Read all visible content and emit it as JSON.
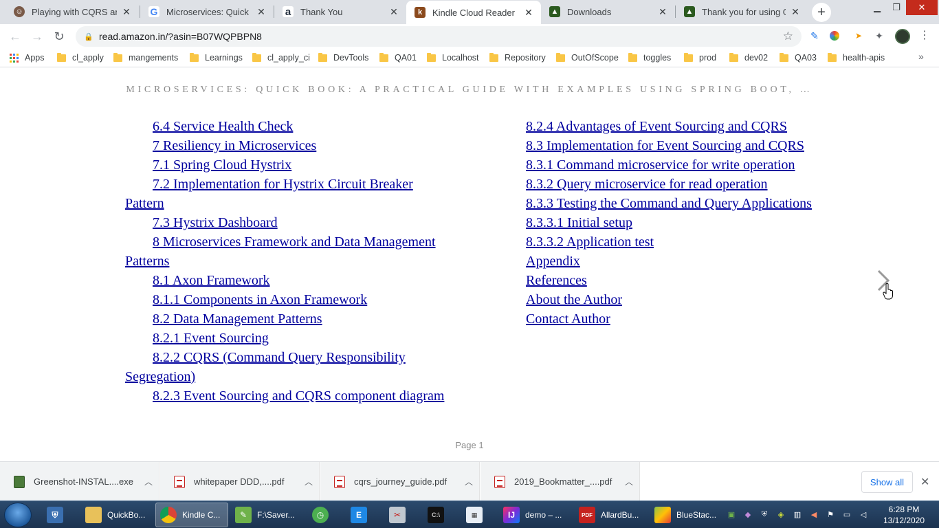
{
  "browser": {
    "tabs": [
      {
        "title": "Playing with CQRS and E",
        "icon": "avatar-favicon-icon",
        "color": "#7a5a48"
      },
      {
        "title": "Microservices: Quick Boo",
        "icon": "google-favicon-icon",
        "color": "#4285f4"
      },
      {
        "title": "Thank You",
        "icon": "amazon-favicon-icon",
        "color": "#232f3e"
      },
      {
        "title": "Kindle Cloud Reader",
        "icon": "kindle-favicon-icon",
        "color": "#8b4a1d"
      },
      {
        "title": "Downloads",
        "icon": "greenshot-favicon-icon",
        "color": "#2b5a1f"
      },
      {
        "title": "Thank you for using Gree",
        "icon": "greenshot-favicon-icon",
        "color": "#2b5a1f"
      }
    ],
    "active_tab": 3,
    "new_tab_symbol": "+",
    "address": "read.amazon.in/?asin=B07WQPBPN8",
    "bookmarks": [
      {
        "label": "Apps",
        "type": "apps"
      },
      {
        "label": "cl_apply",
        "type": "folder"
      },
      {
        "label": "mangements",
        "type": "folder"
      },
      {
        "label": "Learnings",
        "type": "folder"
      },
      {
        "label": "cl_apply_ci",
        "type": "folder"
      },
      {
        "label": "DevTools",
        "type": "folder"
      },
      {
        "label": "QA01",
        "type": "folder"
      },
      {
        "label": "Localhost",
        "type": "folder"
      },
      {
        "label": "Repository",
        "type": "folder"
      },
      {
        "label": "OutOfScope",
        "type": "folder"
      },
      {
        "label": "toggles",
        "type": "folder"
      },
      {
        "label": "prod",
        "type": "folder"
      },
      {
        "label": "dev02",
        "type": "folder"
      },
      {
        "label": "QA03",
        "type": "folder"
      },
      {
        "label": "health-apis",
        "type": "folder"
      }
    ],
    "bookmarks_more": "»"
  },
  "reader": {
    "book_title": "MICROSERVICES: QUICK BOOK: A PRACTICAL GUIDE WITH EXAMPLES USING SPRING BOOT, …",
    "toc_left": [
      "6.4 Service Health Check",
      "7 Resiliency in Microservices",
      "7.1 Spring Cloud Hystrix",
      "7.2 Implementation for Hystrix Circuit Breaker Pattern",
      "7.3 Hystrix Dashboard",
      "8 Microservices Framework and Data Management Patterns",
      "8.1 Axon Framework",
      "8.1.1 Components in Axon Framework",
      "8.2 Data Management Patterns",
      "8.2.1 Event Sourcing",
      "8.2.2 CQRS (Command Query Responsibility Segregation)",
      "8.2.3 Event Sourcing and CQRS component diagram"
    ],
    "toc_right": [
      "8.2.4 Advantages of Event Sourcing and CQRS",
      "8.3 Implementation for Event Sourcing and CQRS",
      "8.3.1 Command microservice for write operation",
      "8.3.2 Query microservice for read operation",
      "8.3.3 Testing the Command and Query Applications",
      "8.3.3.1 Initial setup",
      "8.3.3.2 Application test",
      "Appendix",
      "References",
      "About the Author",
      "Contact Author"
    ],
    "page_label": "Page 1",
    "link_color": "#00009e"
  },
  "downloads": {
    "items": [
      {
        "name": "Greenshot-INSTAL....exe",
        "icon": "exe-file-icon"
      },
      {
        "name": "whitepaper DDD,....pdf",
        "icon": "pdf-file-icon"
      },
      {
        "name": "cqrs_journey_guide.pdf",
        "icon": "pdf-file-icon"
      },
      {
        "name": "2019_Bookmatter_....pdf",
        "icon": "pdf-file-icon"
      }
    ],
    "show_all": "Show all"
  },
  "taskbar": {
    "items": [
      {
        "label": "",
        "icon": "windows-security-icon",
        "color": "#3a6fb0"
      },
      {
        "label": "QuickBo...",
        "icon": "folder-icon",
        "color": "#e8c15a"
      },
      {
        "label": "Kindle C...",
        "icon": "chrome-icon",
        "color": "#db4437"
      },
      {
        "label": "F:\\Saver...",
        "icon": "notepad-plus-icon",
        "color": "#6fb24a"
      },
      {
        "label": "",
        "icon": "clock-app-icon",
        "color": "#4caf50"
      },
      {
        "label": "",
        "icon": "editor-app-icon",
        "color": "#1e88e5"
      },
      {
        "label": "",
        "icon": "snipping-tool-icon",
        "color": "#c0c8d0"
      },
      {
        "label": "",
        "icon": "cmd-icon",
        "color": "#111111"
      },
      {
        "label": "",
        "icon": "calendar-app-icon",
        "color": "#e8eef5"
      },
      {
        "label": "demo – ...",
        "icon": "intellij-icon",
        "color": "#fe315d"
      },
      {
        "label": "AllardBu...",
        "icon": "pdf-reader-icon",
        "color": "#c5221f"
      },
      {
        "label": "BlueStac...",
        "icon": "bluestacks-icon",
        "color": "#8bc34a"
      }
    ],
    "time": "6:28 PM",
    "date": "13/12/2020"
  }
}
